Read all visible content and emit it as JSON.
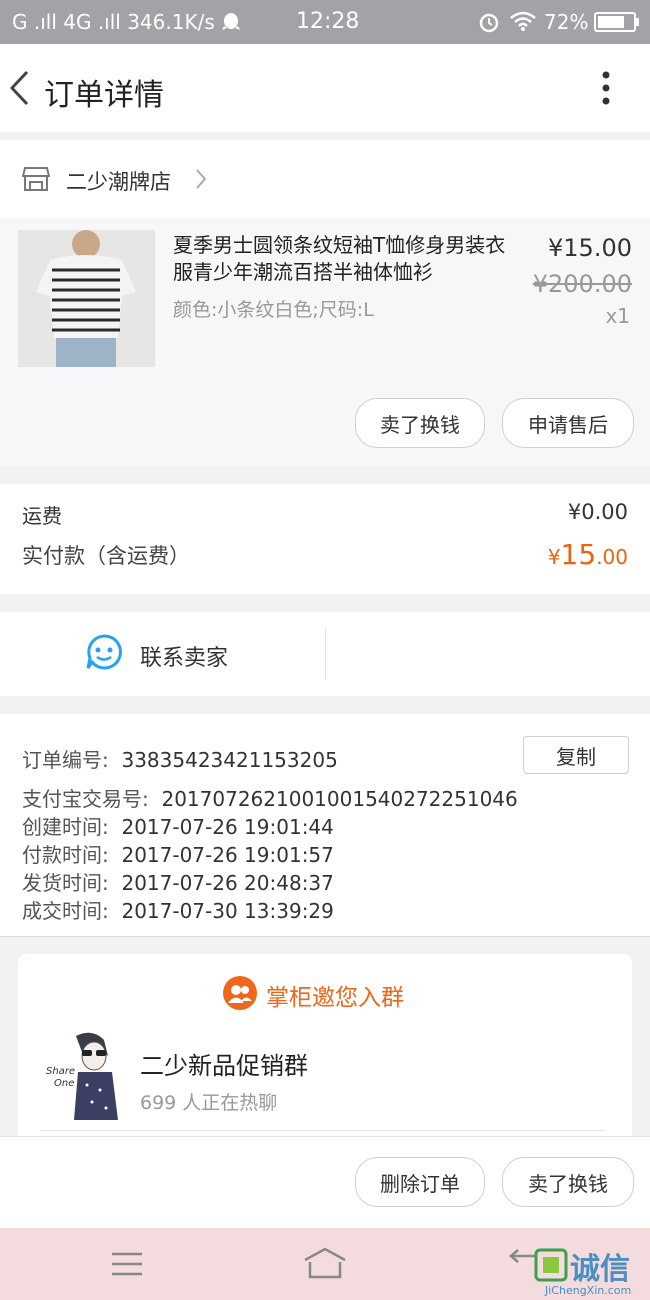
{
  "status_bar": {
    "left": "G .ıll  4G .ıll  346.1K/s",
    "time": "12:28",
    "battery": "72%",
    "icons": [
      "signal-icon",
      "qq-icon",
      "alarm-icon",
      "wifi-icon",
      "battery-icon"
    ]
  },
  "header": {
    "title": "订单详情"
  },
  "shop": {
    "name": "二少潮牌店"
  },
  "product": {
    "title": "夏季男士圆领条纹短袖T恤修身男装衣服青少年潮流百搭半袖体恤衫",
    "spec": "颜色:小条纹白色;尺码:L",
    "price": "¥15.00",
    "original_price": "¥200.00",
    "qty": "x1",
    "actions": [
      "卖了换钱",
      "申请售后"
    ]
  },
  "fees": {
    "shipping_label": "运费",
    "shipping_value": "¥0.00",
    "paid_label": "实付款（含运费）",
    "paid_currency": "¥",
    "paid_int": "15",
    "paid_dec": ".00"
  },
  "contact": {
    "label": "联系卖家"
  },
  "order_info": {
    "copy_label": "复制",
    "rows": [
      {
        "label": "订单编号:",
        "value": "33835423421153205"
      },
      {
        "label": "支付宝交易号:",
        "value": "2017072621001001540272251046"
      },
      {
        "label": "创建时间:",
        "value": "2017-07-26 19:01:44"
      },
      {
        "label": "付款时间:",
        "value": "2017-07-26 19:01:57"
      },
      {
        "label": "发货时间:",
        "value": "2017-07-26 20:48:37"
      },
      {
        "label": "成交时间:",
        "value": "2017-07-30 13:39:29"
      }
    ]
  },
  "group": {
    "header": "掌柜邀您入群",
    "name": "二少新品促销群",
    "members": "699 人正在热聊",
    "avatar_text": [
      "Share",
      "One"
    ]
  },
  "bottom_actions": [
    "删除订单",
    "卖了换钱"
  ],
  "watermark": {
    "text": "诚信",
    "sub": "JiChengXin.com"
  },
  "colors": {
    "accent": "#e8650d",
    "group_accent": "#f0661a",
    "contact_icon": "#23a3f0"
  }
}
